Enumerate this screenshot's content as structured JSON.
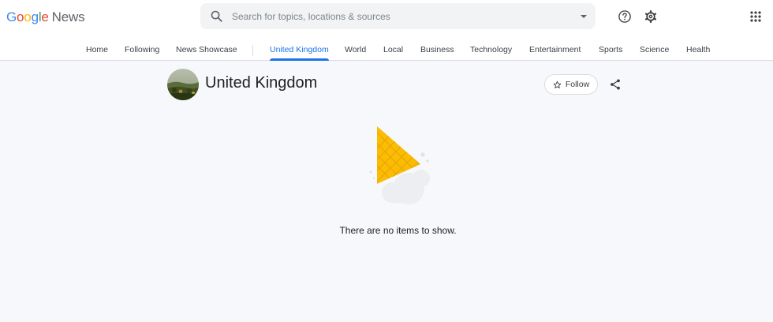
{
  "logo": {
    "google": [
      "G",
      "o",
      "o",
      "g",
      "l",
      "e"
    ],
    "product": "News"
  },
  "colors": {
    "blue": "#4285f4",
    "red": "#ea4335",
    "yellow": "#fbbc04",
    "green": "#34a853",
    "accent": "#1a73e8"
  },
  "search": {
    "placeholder": "Search for topics, locations & sources",
    "value": ""
  },
  "header_icons": {
    "help": "help-circle-icon",
    "settings": "gear-icon",
    "apps": "apps-grid-icon"
  },
  "nav": {
    "items": [
      {
        "label": "Home"
      },
      {
        "label": "Following"
      },
      {
        "label": "News Showcase"
      },
      {
        "label": "United Kingdom",
        "active": true
      },
      {
        "label": "World"
      },
      {
        "label": "Local"
      },
      {
        "label": "Business"
      },
      {
        "label": "Technology"
      },
      {
        "label": "Entertainment"
      },
      {
        "label": "Sports"
      },
      {
        "label": "Science"
      },
      {
        "label": "Health"
      }
    ]
  },
  "topic": {
    "title": "United Kingdom",
    "follow_label": "Follow",
    "follow_icon": "star-outline-icon",
    "share_icon": "share-icon"
  },
  "empty_state": {
    "message": "There are no items to show."
  }
}
